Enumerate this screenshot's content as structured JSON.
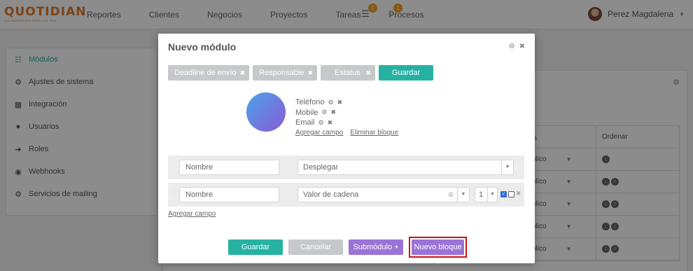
{
  "logo": {
    "text": "QUOTIDIAN",
    "tagline": "COLABORACIÓN PARA LOS RUS"
  },
  "nav": [
    "Reportes",
    "Clientes",
    "Negocios",
    "Proyectos",
    "Tareas",
    "Procesos"
  ],
  "notifications": {
    "list_badge": "0",
    "bell_badge": "1"
  },
  "user": {
    "name": "Perez Magdalena"
  },
  "sidebar": [
    {
      "label": "Módulos",
      "icon": "sitemap-icon"
    },
    {
      "label": "Ajustes de sistema",
      "icon": "cogs-icon"
    },
    {
      "label": "Integración",
      "icon": "puzzle-icon"
    },
    {
      "label": "Usuarios",
      "icon": "user-icon"
    },
    {
      "label": "Roles",
      "icon": "arrow-right-icon"
    },
    {
      "label": "Webhooks",
      "icon": "globe-icon"
    },
    {
      "label": "Servicios de mailing",
      "icon": "gear-icon"
    }
  ],
  "bg_table": {
    "headers": [
      "s",
      "Ordenar"
    ],
    "rows": [
      "blico",
      "blico",
      "blico",
      "blico",
      "blico"
    ]
  },
  "modal": {
    "title": "Nuevo módulo",
    "chips": [
      "Deadline de envío",
      "Responsable",
      "Estatus"
    ],
    "save_top": "Guardar",
    "fields": [
      "Teléfono",
      "Mobile",
      "Email"
    ],
    "add_field_link": "Agregar campo",
    "delete_block_link": "Eliminar bloque",
    "row1": {
      "name_placeholder": "Nombre",
      "select": "Desplegar"
    },
    "row2": {
      "name_placeholder": "Nombre",
      "select": "Valor de cadena",
      "number": "1"
    },
    "add_field_bottom": "Agregar campo",
    "buttons": {
      "save": "Guardar",
      "cancel": "Cancelar",
      "submodule": "Submódulo +",
      "new_block": "Nuevo bloque +"
    }
  },
  "colors": {
    "teal": "#26b1a3",
    "purple": "#9b73d6",
    "gray_chip": "#c6c8cc",
    "highlight": "#d01010"
  }
}
